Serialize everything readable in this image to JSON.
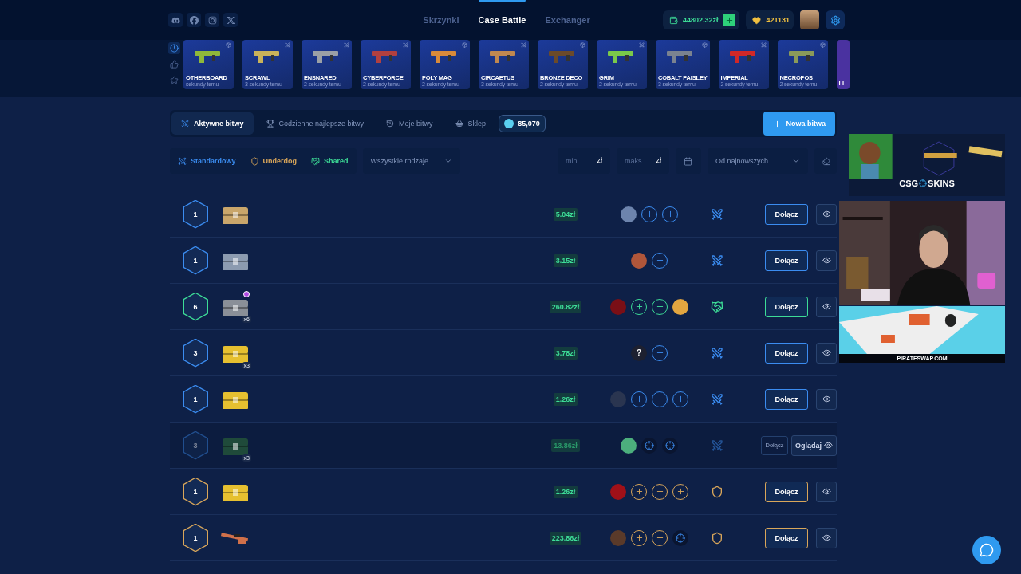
{
  "header": {
    "social": [
      {
        "kind": "discord"
      },
      {
        "kind": "facebook"
      },
      {
        "kind": "instagram"
      },
      {
        "kind": "x"
      }
    ],
    "nav": [
      {
        "label": "Skrzynki",
        "selected": false
      },
      {
        "label": "Case Battle",
        "selected": true
      },
      {
        "label": "Exchanger",
        "selected": false
      }
    ],
    "balance": "44802.32zł",
    "points": "421131"
  },
  "drops": {
    "filters": [
      {
        "kind": "recent",
        "selected": true
      },
      {
        "kind": "liked",
        "selected": false
      },
      {
        "kind": "star",
        "selected": false
      }
    ],
    "items": [
      {
        "name": "OTHERBOARD",
        "time": "sekundy temu",
        "kind": "case",
        "color": "#8fb83a"
      },
      {
        "name": "SCRAWL",
        "time": "3 sekundy temu",
        "kind": "battle",
        "color": "#c9b25a"
      },
      {
        "name": "ENSNARED",
        "time": "2 sekundy temu",
        "kind": "battle",
        "color": "#9aa0a6"
      },
      {
        "name": "CYBERFORCE",
        "time": "2 sekundy temu",
        "kind": "battle",
        "color": "#b04040"
      },
      {
        "name": "POLY MAG",
        "time": "2 sekundy temu",
        "kind": "case",
        "color": "#d98a3a"
      },
      {
        "name": "CIRCAETUS",
        "time": "3 sekundy temu",
        "kind": "battle",
        "color": "#c08850"
      },
      {
        "name": "BRONZE DECO",
        "time": "2 sekundy temu",
        "kind": "case",
        "color": "#6b4a2a"
      },
      {
        "name": "GRIM",
        "time": "2 sekundy temu",
        "kind": "battle",
        "color": "#7ac94a"
      },
      {
        "name": "COBALT PAISLEY",
        "time": "3 sekundy temu",
        "kind": "case",
        "color": "#7a8290"
      },
      {
        "name": "IMPERIAL",
        "time": "2 sekundy temu",
        "kind": "battle",
        "color": "#d02828"
      },
      {
        "name": "NECROPOS",
        "time": "2 sekundy temu",
        "kind": "case",
        "color": "#8a9a5a"
      },
      {
        "name": "LI",
        "kind": "partial",
        "color": "#4a32a0"
      }
    ]
  },
  "tabs": [
    {
      "label": "Aktywne bitwy",
      "kind": "active",
      "selected": true
    },
    {
      "label": "Codzienne najlepsze bitwy",
      "kind": "daily",
      "selected": false
    },
    {
      "label": "Moje bitwy",
      "kind": "mine",
      "selected": false
    },
    {
      "label": "Sklep",
      "kind": "shop",
      "selected": false
    }
  ],
  "coins": "85,070",
  "new_battle": "Nowa bitwa",
  "filters": {
    "modes": [
      {
        "label": "Standardowy",
        "kind": "standard"
      },
      {
        "label": "Underdog",
        "kind": "underdog"
      },
      {
        "label": "Shared",
        "kind": "shared"
      }
    ],
    "type": "Wszystkie rodzaje",
    "min": {
      "placeholder": "min.",
      "unit": "zł"
    },
    "max": {
      "placeholder": "maks.",
      "unit": "zł"
    },
    "sort": "Od najnowszych"
  },
  "battles": [
    {
      "rounds": "1",
      "kind": "standard",
      "case": {
        "kind": "chest",
        "color": "#c9a66b"
      },
      "price": "5.04zł",
      "players": [
        {
          "kind": "avatar",
          "color": "#6d84ad"
        },
        {
          "kind": "join"
        },
        {
          "kind": "join"
        }
      ],
      "join": "Dołącz",
      "disabled": false
    },
    {
      "rounds": "1",
      "kind": "standard",
      "case": {
        "kind": "chest",
        "color": "#8c9bb0"
      },
      "price": "3.15zł",
      "players": [
        {
          "kind": "avatar",
          "color": "#b0563a"
        },
        {
          "kind": "join"
        }
      ],
      "join": "Dołącz",
      "disabled": false
    },
    {
      "rounds": "6",
      "kind": "shared",
      "case": {
        "kind": "chest",
        "color": "#8a8f98",
        "count": "x6",
        "vip": true
      },
      "price": "260.82zł",
      "players": [
        {
          "kind": "avatar",
          "color": "#7a0f16"
        },
        {
          "kind": "join"
        },
        {
          "kind": "join"
        },
        {
          "kind": "avatar",
          "color": "#e3a640"
        }
      ],
      "join": "Dołącz",
      "disabled": false
    },
    {
      "rounds": "3",
      "kind": "standard",
      "case": {
        "kind": "chest",
        "color": "#e6c030",
        "count": "x3"
      },
      "price": "3.78zł",
      "players": [
        {
          "kind": "unknown",
          "label": "?"
        },
        {
          "kind": "join"
        }
      ],
      "join": "Dołącz",
      "disabled": false
    },
    {
      "rounds": "1",
      "kind": "standard",
      "case": {
        "kind": "chest",
        "color": "#e6c030"
      },
      "price": "1.26zł",
      "players": [
        {
          "kind": "avatar",
          "color": "#2a3550"
        },
        {
          "kind": "join"
        },
        {
          "kind": "join"
        },
        {
          "kind": "join"
        }
      ],
      "join": "Dołącz",
      "disabled": false
    },
    {
      "rounds": "3",
      "kind": "standard",
      "case": {
        "kind": "chest",
        "color": "#1f4a3a",
        "count": "x3"
      },
      "price": "13.86zł",
      "players": [
        {
          "kind": "avatar",
          "color": "#4caf7d"
        },
        {
          "kind": "spectate"
        },
        {
          "kind": "spectate"
        }
      ],
      "join": "Dołącz",
      "watch": "Oglądaj",
      "disabled": true
    },
    {
      "rounds": "1",
      "kind": "underdog",
      "case": {
        "kind": "chest",
        "color": "#e6c030"
      },
      "price": "1.26zł",
      "players": [
        {
          "kind": "avatar",
          "color": "#a01018"
        },
        {
          "kind": "join"
        },
        {
          "kind": "join"
        },
        {
          "kind": "join"
        }
      ],
      "join": "Dołącz",
      "disabled": false
    },
    {
      "rounds": "1",
      "kind": "underdog",
      "case": {
        "kind": "rifle",
        "color": "#d0704a"
      },
      "price": "223.86zł",
      "players": [
        {
          "kind": "avatar",
          "color": "#5a3a2a"
        },
        {
          "kind": "join"
        },
        {
          "kind": "join"
        },
        {
          "kind": "spectate"
        }
      ],
      "join": "Dołącz",
      "disabled": false
    }
  ],
  "stream": {
    "sponsor_left": "CSG",
    "sponsor_right": "SKINS",
    "footer": "PIRATESWAP.COM"
  }
}
